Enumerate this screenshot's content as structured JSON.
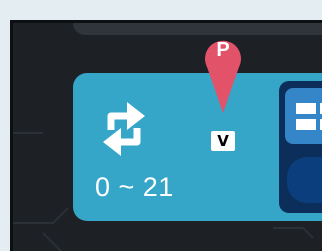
{
  "block": {
    "icon": "repeat-icon",
    "range_text": "0 ~ 21",
    "value_badge": "V",
    "sub_icon": "grid-icon"
  },
  "marker": {
    "letter": "P",
    "color": "#e25268"
  },
  "colors": {
    "block": "#35a6c8",
    "background_panel": "#1d2126",
    "sub_panel": "#0b2e5a",
    "sub_tile": "#3585c9"
  }
}
